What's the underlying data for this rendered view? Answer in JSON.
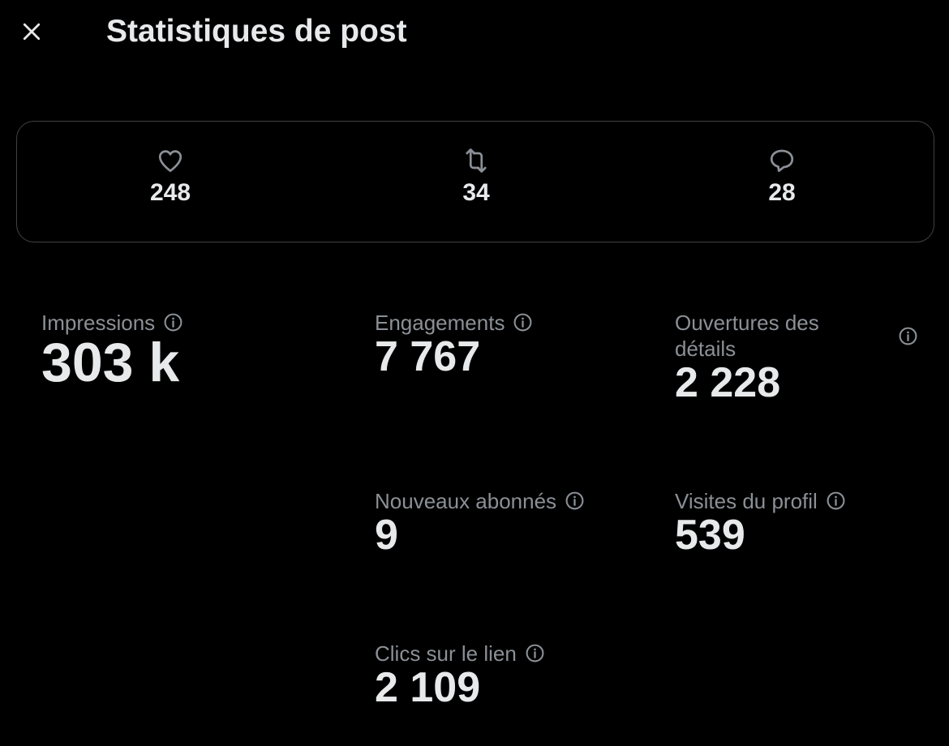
{
  "header": {
    "title": "Statistiques de post",
    "close_icon": "close-icon"
  },
  "summary": {
    "likes": {
      "icon": "heart-icon",
      "value": "248"
    },
    "reposts": {
      "icon": "repost-icon",
      "value": "34"
    },
    "replies": {
      "icon": "reply-icon",
      "value": "28"
    }
  },
  "metrics": {
    "impressions": {
      "label": "Impressions",
      "value": "303 k"
    },
    "engagements": {
      "label": "Engagements",
      "value": "7 767"
    },
    "detail_expands": {
      "label": "Ouvertures des détails",
      "value": "2 228"
    },
    "new_followers": {
      "label": "Nouveaux abonnés",
      "value": "9"
    },
    "profile_visits": {
      "label": "Visites du profil",
      "value": "539"
    },
    "link_clicks": {
      "label": "Clics sur le lien",
      "value": "2 109"
    }
  },
  "colors": {
    "background": "#000000",
    "text_primary": "#e7e9ea",
    "text_secondary": "#8b9096",
    "border": "#3e4144"
  }
}
